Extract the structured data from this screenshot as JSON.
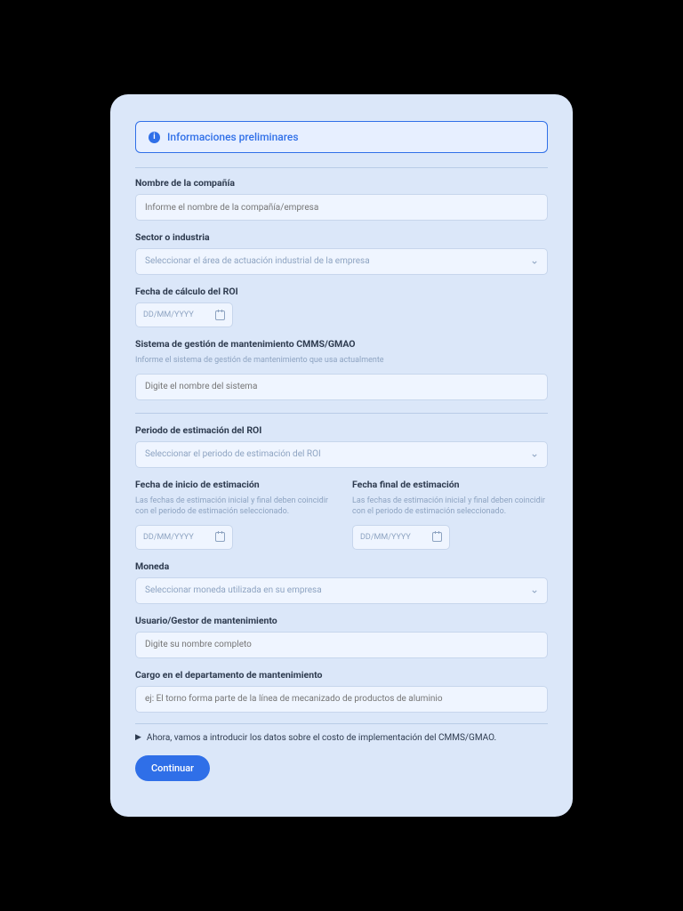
{
  "banner": {
    "title": "Informaciones preliminares"
  },
  "fields": {
    "company": {
      "label": "Nombre de la compañía",
      "placeholder": "Informe el nombre de la compañía/empresa"
    },
    "sector": {
      "label": "Sector o industria",
      "placeholder": "Seleccionar el área de actuación industrial de la empresa"
    },
    "roiDate": {
      "label": "Fecha de cálculo del ROI",
      "placeholder": "DD/MM/YYYY"
    },
    "cmms": {
      "label": "Sistema de gestión de mantenimiento CMMS/GMAO",
      "helper": "Informe el sistema de gestión de mantenimiento que usa actualmente",
      "placeholder": "Digite el nombre del sistema"
    },
    "roiPeriod": {
      "label": "Periodo de estimación del ROI",
      "placeholder": "Seleccionar el periodo de estimación del ROI"
    },
    "startDate": {
      "label": "Fecha de inicio de estimación",
      "helper": "Las fechas de estimación inicial y final deben coincidir con el periodo de estimación seleccionado.",
      "placeholder": "DD/MM/YYYY"
    },
    "endDate": {
      "label": "Fecha final de estimación",
      "helper": "Las fechas de estimación inicial y final deben coincidir con el periodo de estimación seleccionado.",
      "placeholder": "DD/MM/YYYY"
    },
    "currency": {
      "label": "Moneda",
      "placeholder": "Seleccionar moneda utilizada en su empresa"
    },
    "user": {
      "label": "Usuario/Gestor de mantenimiento",
      "placeholder": "Digite su nombre completo"
    },
    "role": {
      "label": "Cargo en el departamento de mantenimiento",
      "placeholder": "ej: El torno forma parte de la línea de mecanizado de productos de aluminio"
    }
  },
  "tip": "Ahora, vamos a introducir los datos sobre el costo de implementación del CMMS/GMAO.",
  "buttons": {
    "continue": "Continuar"
  }
}
